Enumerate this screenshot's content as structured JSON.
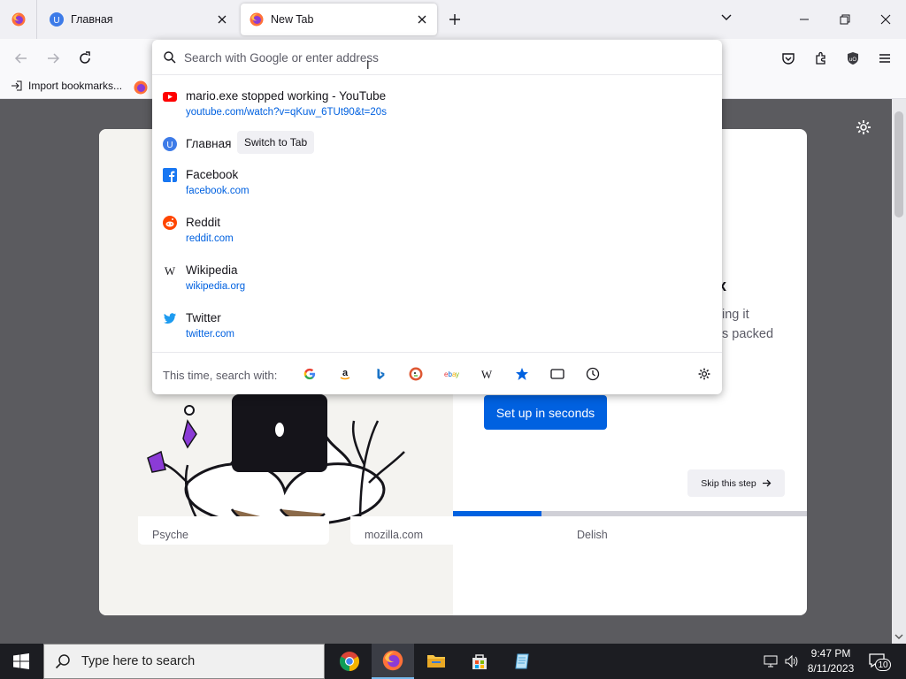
{
  "browser": {
    "tabs": [
      {
        "title": "Главная",
        "favicon_letter": "U",
        "favicon_color": "#3d7be8"
      },
      {
        "title": "New Tab",
        "active": true
      }
    ],
    "bookmarks_bar": {
      "import_label": "Import bookmarks..."
    }
  },
  "urlbar": {
    "placeholder": "Search with Google or enter address",
    "results": [
      {
        "icon": "youtube-icon",
        "title": "mario.exe stopped working - YouTube",
        "url": "youtube.com/watch?v=qKuw_6TUt90&t=20s"
      },
      {
        "icon": "tab-favicon-u",
        "title": "Главная",
        "action": "Switch to Tab"
      },
      {
        "icon": "facebook-icon",
        "title": "Facebook",
        "url": "facebook.com"
      },
      {
        "icon": "reddit-icon",
        "title": "Reddit",
        "url": "reddit.com"
      },
      {
        "icon": "wikipedia-icon",
        "title": "Wikipedia",
        "url": "wikipedia.org"
      },
      {
        "icon": "twitter-icon",
        "title": "Twitter",
        "url": "twitter.com"
      }
    ],
    "one_off_label": "This time, search with:",
    "one_off_engines": [
      "google-icon",
      "amazon-icon",
      "bing-icon",
      "duckduckgo-icon",
      "ebay-icon",
      "wikipedia-icon",
      "bookmarks-icon",
      "tabs-icon",
      "history-icon"
    ]
  },
  "onboarding": {
    "title_fragment": "ox",
    "desc_fragments": [
      "ing it",
      "s packed"
    ],
    "setup_label": "Set up in seconds",
    "skip_label": "Skip this step",
    "progress": 0.25
  },
  "top_sites": [
    "Psyche",
    "mozilla.com",
    "Delish"
  ],
  "taskbar": {
    "search_placeholder": "Type here to search",
    "time": "9:47 PM",
    "date": "8/11/2023",
    "notifications": "10"
  },
  "colors": {
    "accent": "#0061e0",
    "youtube": "#ff0000",
    "facebook": "#1877f2",
    "reddit": "#ff4500",
    "twitter": "#1d9bf0"
  }
}
